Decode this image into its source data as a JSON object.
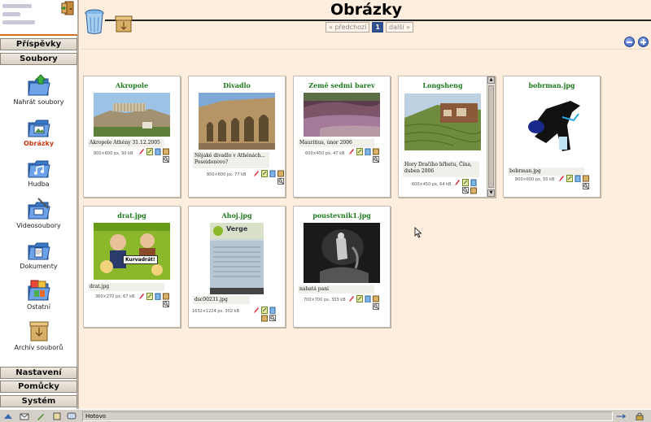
{
  "header": {
    "title": "Obrázky"
  },
  "pager": {
    "prev": "« předchozí",
    "current": "1",
    "next": "další »"
  },
  "sidebar": {
    "top_sections": [
      {
        "label": "Příspěvky"
      },
      {
        "label": "Soubory"
      }
    ],
    "items": [
      {
        "label": "Nahrát soubory",
        "icon": "upload-folder-icon"
      },
      {
        "label": "Obrázky",
        "icon": "images-folder-icon",
        "active": true
      },
      {
        "label": "Hudba",
        "icon": "music-folder-icon"
      },
      {
        "label": "Videosoubory",
        "icon": "video-folder-icon"
      },
      {
        "label": "Dokumenty",
        "icon": "documents-folder-icon"
      },
      {
        "label": "Ostatní",
        "icon": "other-folder-icon"
      },
      {
        "label": "Archív souborů",
        "icon": "archive-box-icon"
      }
    ],
    "bottom_sections": [
      {
        "label": "Nastavení"
      },
      {
        "label": "Pomůcky"
      },
      {
        "label": "Systém"
      }
    ]
  },
  "images": [
    {
      "title": "Akropole",
      "caption": "Akropole Athény 31.12.2005",
      "meta": "800×600 px, 90 kB"
    },
    {
      "title": "Divadlo",
      "caption": "Nějaké divadlo v Athénách... Poseidonovo?",
      "meta": "800×600 px, 77 kB"
    },
    {
      "title": "Země sedmi barev",
      "caption": "Mauritius, únor 2006",
      "meta": "600×450 px, 47 kB"
    },
    {
      "title": "Longsheng",
      "caption": "Hory Dračího hřbetu, Čína, duben 2006",
      "meta": "600×450 px, 64 kB"
    },
    {
      "title": "bobrman.jpg",
      "caption": "bobrman.jpg",
      "meta": "800×600 px, 50 kB"
    },
    {
      "title": "drat.jpg",
      "caption": "drat.jpg",
      "meta": "360×270 px, 67 kB",
      "inner_text": "Kurvadrát!"
    },
    {
      "title": "Ahoj.jpg",
      "caption": "dsc00231.jpg",
      "meta": "1632×1224 px, 302 kB",
      "inner_text": "Verge"
    },
    {
      "title": "poustevnik1.jpg",
      "caption": "nahatá paní",
      "meta": "700×700 px, 303 kB"
    }
  ],
  "statusbar": {
    "text": "Hotovo"
  },
  "colors": {
    "accent_title": "#1f7a1f",
    "active_nav": "#c63a12",
    "page_bg": "#ffeedd"
  }
}
